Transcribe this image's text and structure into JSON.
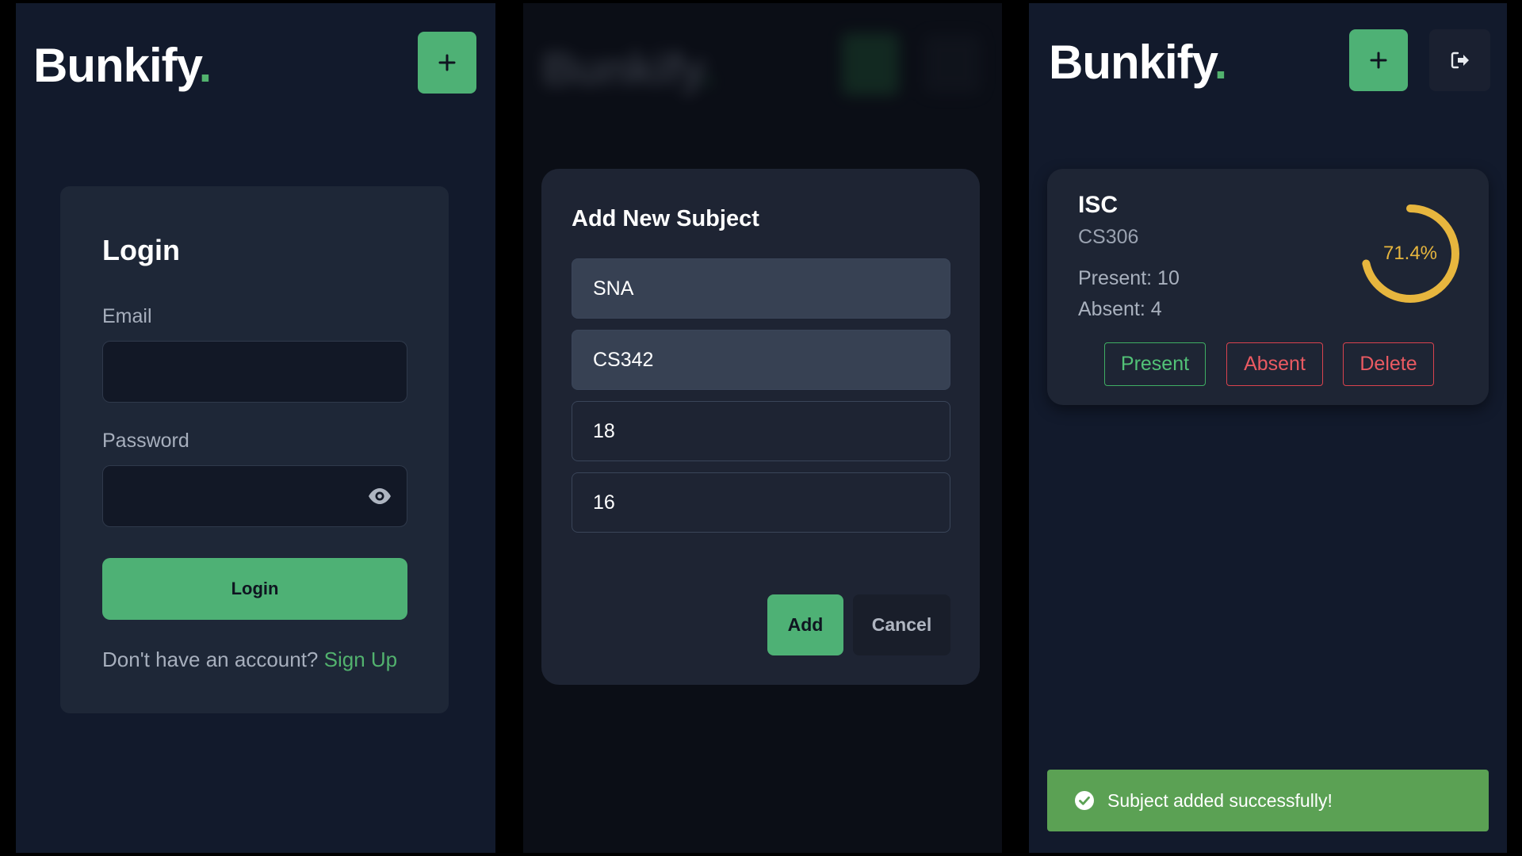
{
  "brand": {
    "name": "Bunkify",
    "dot": "."
  },
  "icons": {
    "add": "plus-icon",
    "logout": "logout-icon",
    "eye": "eye-icon",
    "check": "check-circle-icon"
  },
  "colors": {
    "accent": "#4eb175",
    "danger": "#d9434e",
    "ring": "#e7b63e",
    "toast": "#5ba154"
  },
  "login_screen": {
    "add_button_label": "+",
    "title": "Login",
    "email_label": "Email",
    "email_value": "",
    "password_label": "Password",
    "password_value": "",
    "submit_label": "Login",
    "signup_prompt": "Don't have an account?",
    "signup_link": "Sign Up"
  },
  "add_subject_modal": {
    "title": "Add New Subject",
    "fields": [
      {
        "value": "SNA"
      },
      {
        "value": "CS342"
      },
      {
        "value": "18"
      },
      {
        "value": "16"
      }
    ],
    "add_label": "Add",
    "cancel_label": "Cancel"
  },
  "dashboard": {
    "add_button_label": "+",
    "subject": {
      "name": "ISC",
      "code": "CS306",
      "present_text": "Present: 10",
      "absent_text": "Absent: 4",
      "percentage": 71.4,
      "percentage_text": "71.4%"
    },
    "actions": {
      "present": "Present",
      "absent": "Absent",
      "delete": "Delete"
    },
    "toast": "Subject added successfully!"
  }
}
